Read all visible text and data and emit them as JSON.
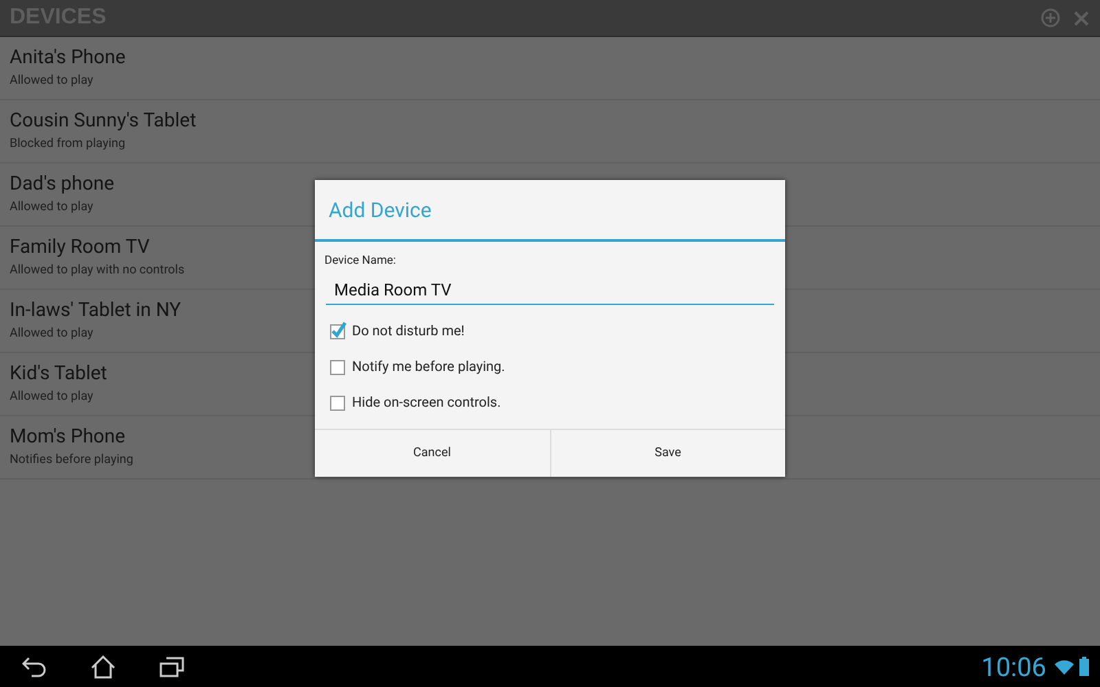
{
  "app_bar": {
    "title": "DEVICES"
  },
  "devices": [
    {
      "name": "Anita's Phone",
      "status": "Allowed to play"
    },
    {
      "name": "Cousin Sunny's Tablet",
      "status": "Blocked from playing"
    },
    {
      "name": "Dad's phone",
      "status": "Allowed to play"
    },
    {
      "name": "Family Room TV",
      "status": "Allowed to play with no controls"
    },
    {
      "name": "In-laws' Tablet in NY",
      "status": "Allowed to play"
    },
    {
      "name": "Kid's Tablet",
      "status": "Allowed to play"
    },
    {
      "name": "Mom's Phone",
      "status": "Notifies before playing"
    }
  ],
  "dialog": {
    "title": "Add Device",
    "field_label": "Device Name:",
    "field_value": "Media Room TV",
    "options": [
      {
        "label": "Do not disturb me!",
        "checked": true
      },
      {
        "label": "Notify me before playing.",
        "checked": false
      },
      {
        "label": "Hide on-screen controls.",
        "checked": false
      }
    ],
    "buttons": [
      "Cancel",
      "Save"
    ]
  },
  "status_bar": {
    "time": "10:06"
  }
}
